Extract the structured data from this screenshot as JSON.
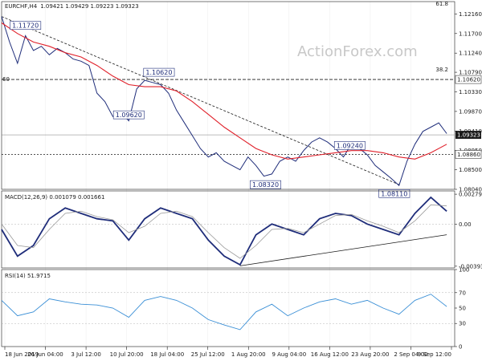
{
  "chart_data": {
    "type": "line",
    "symbol": "EURCHF",
    "timeframe": "H4",
    "title": "EURCHF,H4",
    "ohlc_header": "1.09421 1.09429 1.09223 1.09323",
    "watermark": "ActionForex.com",
    "x_labels": [
      "18 Jun 2019",
      "26 Jun 04:00",
      "3 Jul 12:00",
      "10 Jul 20:00",
      "18 Jul 04:00",
      "25 Jul 12:00",
      "1 Aug 20:00",
      "9 Aug 04:00",
      "16 Aug 12:00",
      "23 Aug 20:00",
      "2 Sep 04:00",
      "9 Sep 12:00"
    ],
    "price_panel": {
      "ylim": [
        1.0804,
        1.1245
      ],
      "y_ticks": [
        "1.12160",
        "1.11700",
        "1.11240",
        "1.10790",
        "1.10330",
        "1.09870",
        "1.09410",
        "1.08950",
        "1.08500",
        "1.08040"
      ],
      "fib_top_label": "61.8",
      "fib_mid_label": "38.2",
      "fib_mid_left_label": "60",
      "level_lines": [
        {
          "value": 1.1062,
          "label": "1.10620",
          "style": "dashed"
        },
        {
          "value": 1.0886,
          "label": "1.08860",
          "style": "dotted"
        }
      ],
      "current_price": {
        "value": 1.0932,
        "label": "1.09323"
      },
      "annotations": [
        {
          "label": "1.11720",
          "x": 0.15,
          "y": 1.1172
        },
        {
          "label": "1.10620",
          "x": 0.99,
          "y": 1.1062
        },
        {
          "label": "1.09620",
          "x": 0.8,
          "y": 1.0962
        },
        {
          "label": "1.08320",
          "x": 1.66,
          "y": 1.0832
        },
        {
          "label": "1.09240",
          "x": 2.19,
          "y": 1.0924
        },
        {
          "label": "1.08110",
          "x": 2.47,
          "y": 1.0811
        }
      ],
      "trendline": {
        "x1": 0.0,
        "y1": 1.121,
        "x2": 2.5,
        "y2": 1.0815
      },
      "series": [
        {
          "name": "price",
          "color": "#1f2d7a",
          "x": [
            0.0,
            0.05,
            0.1,
            0.15,
            0.2,
            0.25,
            0.3,
            0.35,
            0.4,
            0.45,
            0.5,
            0.55,
            0.6,
            0.65,
            0.7,
            0.75,
            0.8,
            0.85,
            0.9,
            0.95,
            1.0,
            1.05,
            1.1,
            1.15,
            1.2,
            1.25,
            1.3,
            1.35,
            1.4,
            1.45,
            1.5,
            1.55,
            1.6,
            1.65,
            1.7,
            1.75,
            1.8,
            1.85,
            1.9,
            1.95,
            2.0,
            2.05,
            2.1,
            2.15,
            2.2,
            2.25,
            2.3,
            2.35,
            2.4,
            2.45,
            2.5,
            2.55,
            2.6,
            2.65,
            2.7,
            2.75,
            2.8
          ],
          "values": [
            1.121,
            1.115,
            1.11,
            1.1165,
            1.113,
            1.114,
            1.112,
            1.1135,
            1.1125,
            1.111,
            1.1105,
            1.1095,
            1.103,
            1.101,
            1.0975,
            1.0985,
            1.0965,
            1.104,
            1.106,
            1.1055,
            1.105,
            1.103,
            1.099,
            1.096,
            1.093,
            1.09,
            1.088,
            1.089,
            1.087,
            1.086,
            1.085,
            1.088,
            1.086,
            1.0835,
            1.084,
            1.087,
            1.088,
            1.087,
            1.0895,
            1.0915,
            1.0925,
            1.0915,
            1.09,
            1.088,
            1.091,
            1.09,
            1.0885,
            1.086,
            1.0845,
            1.083,
            1.0813,
            1.087,
            1.091,
            1.094,
            1.095,
            1.096,
            1.0935
          ]
        },
        {
          "name": "ma",
          "color": "#e0202a",
          "x": [
            0.0,
            0.1,
            0.2,
            0.3,
            0.4,
            0.5,
            0.6,
            0.7,
            0.8,
            0.9,
            1.0,
            1.1,
            1.2,
            1.3,
            1.4,
            1.5,
            1.6,
            1.7,
            1.8,
            1.9,
            2.0,
            2.1,
            2.2,
            2.3,
            2.4,
            2.5,
            2.6,
            2.7,
            2.8
          ],
          "values": [
            1.1195,
            1.117,
            1.115,
            1.114,
            1.1125,
            1.1115,
            1.1095,
            1.107,
            1.105,
            1.1045,
            1.1045,
            1.1035,
            1.101,
            1.098,
            1.095,
            1.0925,
            1.09,
            1.0885,
            1.0875,
            1.088,
            1.0885,
            1.089,
            1.0895,
            1.0895,
            1.089,
            1.088,
            1.0875,
            1.089,
            1.091
          ]
        }
      ]
    },
    "macd_panel": {
      "title": "MACD(12,26,9) 0.001079 0.001661",
      "ylim": [
        -0.0041,
        0.0031
      ],
      "y_ticks": [
        "0.002793",
        "0.00",
        "-0.003938"
      ],
      "trendline": {
        "x1": 1.5,
        "y1": -0.0039,
        "x2": 2.8,
        "y2": -0.001
      },
      "series": [
        {
          "name": "macd",
          "color": "#1f2d7a",
          "x": [
            0.0,
            0.1,
            0.2,
            0.3,
            0.4,
            0.5,
            0.6,
            0.7,
            0.8,
            0.9,
            1.0,
            1.1,
            1.2,
            1.3,
            1.4,
            1.5,
            1.6,
            1.7,
            1.8,
            1.9,
            2.0,
            2.1,
            2.2,
            2.3,
            2.4,
            2.5,
            2.6,
            2.7,
            2.8
          ],
          "values": [
            -0.0005,
            -0.003,
            -0.002,
            0.0005,
            0.0015,
            0.001,
            0.0005,
            0.0003,
            -0.0015,
            0.0005,
            0.0015,
            0.001,
            0.0005,
            -0.0015,
            -0.003,
            -0.0038,
            -0.001,
            0.0,
            -0.0005,
            -0.001,
            0.0005,
            0.001,
            0.0008,
            0.0,
            -0.0005,
            -0.001,
            0.001,
            0.0025,
            0.0012
          ]
        },
        {
          "name": "signal",
          "color": "#9a9a9a",
          "x": [
            0.0,
            0.1,
            0.2,
            0.3,
            0.4,
            0.5,
            0.6,
            0.7,
            0.8,
            0.9,
            1.0,
            1.1,
            1.2,
            1.3,
            1.4,
            1.5,
            1.6,
            1.7,
            1.8,
            1.9,
            2.0,
            2.1,
            2.2,
            2.3,
            2.4,
            2.5,
            2.6,
            2.7,
            2.8
          ],
          "values": [
            0.0,
            -0.002,
            -0.0022,
            -0.0005,
            0.001,
            0.0012,
            0.0007,
            0.0004,
            -0.0008,
            -0.0002,
            0.001,
            0.0012,
            0.0007,
            -0.0008,
            -0.0022,
            -0.0032,
            -0.002,
            -0.0005,
            -0.0004,
            -0.0008,
            0.0,
            0.0008,
            0.0009,
            0.0003,
            -0.0002,
            -0.0008,
            0.0003,
            0.0018,
            0.0017
          ]
        }
      ]
    },
    "rsi_panel": {
      "title": "RSI(14) 51.9715",
      "ylim": [
        0,
        100
      ],
      "y_ticks": [
        "100",
        "70",
        "50",
        "30",
        "0"
      ],
      "levels": [
        70,
        30
      ],
      "series": [
        {
          "name": "rsi",
          "color": "#3a8fd6",
          "x": [
            0.0,
            0.1,
            0.2,
            0.3,
            0.4,
            0.5,
            0.6,
            0.7,
            0.8,
            0.9,
            1.0,
            1.1,
            1.2,
            1.3,
            1.4,
            1.5,
            1.6,
            1.7,
            1.8,
            1.9,
            2.0,
            2.1,
            2.2,
            2.3,
            2.4,
            2.5,
            2.6,
            2.7,
            2.8
          ],
          "values": [
            60,
            40,
            45,
            62,
            58,
            55,
            54,
            50,
            38,
            60,
            65,
            60,
            50,
            35,
            28,
            22,
            45,
            55,
            40,
            50,
            58,
            62,
            55,
            60,
            50,
            42,
            60,
            68,
            52
          ]
        }
      ]
    }
  }
}
